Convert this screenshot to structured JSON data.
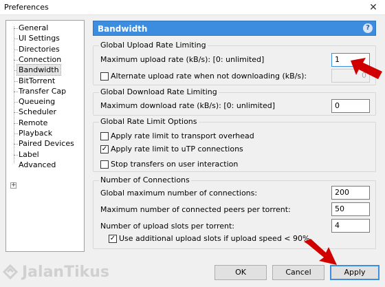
{
  "window": {
    "title": "Preferences",
    "close_glyph": "✕"
  },
  "sidebar": {
    "items": [
      {
        "label": "General"
      },
      {
        "label": "UI Settings"
      },
      {
        "label": "Directories"
      },
      {
        "label": "Connection"
      },
      {
        "label": "Bandwidth",
        "selected": true
      },
      {
        "label": "BitTorrent"
      },
      {
        "label": "Transfer Cap"
      },
      {
        "label": "Queueing"
      },
      {
        "label": "Scheduler"
      },
      {
        "label": "Remote"
      },
      {
        "label": "Playback"
      },
      {
        "label": "Paired Devices"
      },
      {
        "label": "Label"
      },
      {
        "label": "Advanced",
        "expandable": true
      }
    ],
    "expander_glyph": "+"
  },
  "panel": {
    "title": "Bandwidth",
    "help_glyph": "?",
    "header_color": "#3c8de0"
  },
  "upload": {
    "legend": "Global Upload Rate Limiting",
    "max_label": "Maximum upload rate (kB/s): [0: unlimited]",
    "max_value": "1",
    "alt_label": "Alternate upload rate when not downloading (kB/s):",
    "alt_checked": false,
    "alt_value": "0"
  },
  "download": {
    "legend": "Global Download Rate Limiting",
    "max_label": "Maximum download rate (kB/s): [0: unlimited]",
    "max_value": "0"
  },
  "options": {
    "legend": "Global Rate Limit Options",
    "items": [
      {
        "label": "Apply rate limit to transport overhead",
        "checked": false
      },
      {
        "label": "Apply rate limit to uTP connections",
        "checked": true
      },
      {
        "label": "Stop transfers on user interaction",
        "checked": false
      }
    ],
    "check_glyph": "✓"
  },
  "connections": {
    "legend": "Number of Connections",
    "global_label": "Global maximum number of connections:",
    "global_value": "200",
    "peers_label": "Maximum number of connected peers per torrent:",
    "peers_value": "50",
    "slots_label": "Number of upload slots per torrent:",
    "slots_value": "4",
    "extra_label": "Use additional upload slots if upload speed < 90%",
    "extra_checked": true
  },
  "buttons": {
    "ok": "OK",
    "cancel": "Cancel",
    "apply": "Apply"
  },
  "watermark": {
    "text": "JalanTikus"
  },
  "colors": {
    "arrow": "#d10000",
    "accent": "#3c8de0"
  }
}
